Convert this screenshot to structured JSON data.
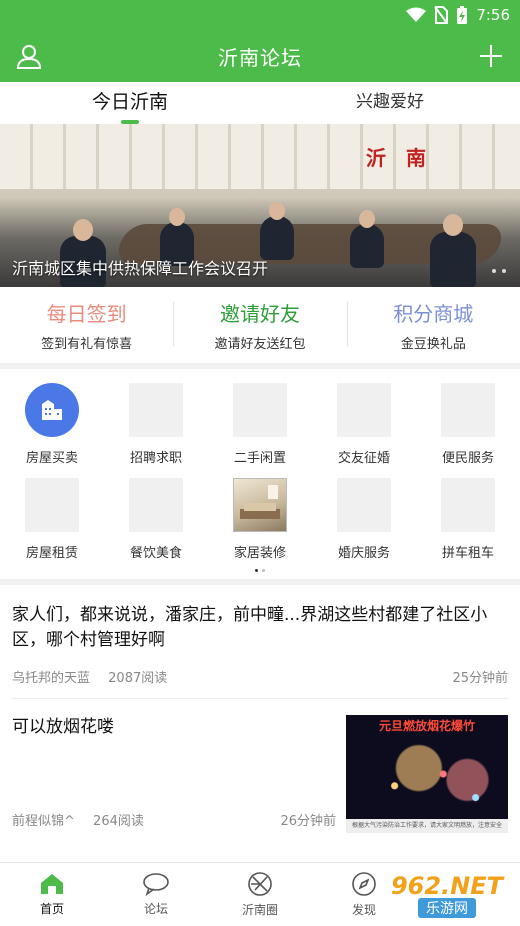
{
  "status": {
    "time": "7:56"
  },
  "header": {
    "title": "沂南论坛"
  },
  "tabs": [
    {
      "label": "今日沂南"
    },
    {
      "label": "兴趣爱好"
    }
  ],
  "banner": {
    "caption": "沂南城区集中供热保障工作会议召开",
    "sign_text": "沂南"
  },
  "quick": [
    {
      "title": "每日签到",
      "sub": "签到有礼有惊喜",
      "color": "#e98c7c"
    },
    {
      "title": "邀请好友",
      "sub": "邀请好友送红包",
      "color": "#2e9e3a"
    },
    {
      "title": "积分商城",
      "sub": "金豆换礼品",
      "color": "#7b8fd4"
    }
  ],
  "grid": [
    {
      "label": "房屋买卖"
    },
    {
      "label": "招聘求职"
    },
    {
      "label": "二手闲置"
    },
    {
      "label": "交友征婚"
    },
    {
      "label": "便民服务"
    },
    {
      "label": "房屋租赁"
    },
    {
      "label": "餐饮美食"
    },
    {
      "label": "家居装修"
    },
    {
      "label": "婚庆服务"
    },
    {
      "label": "拼车租车"
    }
  ],
  "posts": [
    {
      "title": "家人们，都来说说，潘家庄，前中疃...界湖这些村都建了社区小区，哪个村管理好啊",
      "author": "乌托邦的天蓝",
      "reads": "2087阅读",
      "time": "25分钟前"
    },
    {
      "title": "可以放烟花喽",
      "author": "前程似锦^",
      "reads": "264阅读",
      "time": "26分钟前",
      "thumb_title": "元旦燃放烟花爆竹",
      "thumb_foot": "根据大气污染防治工作要求，请大家文明燃放，注意安全"
    }
  ],
  "nav": [
    {
      "label": "首页"
    },
    {
      "label": "论坛"
    },
    {
      "label": "沂南圈"
    },
    {
      "label": "发现"
    }
  ],
  "watermark": {
    "logo": "962.NET",
    "sub": "乐游网"
  }
}
